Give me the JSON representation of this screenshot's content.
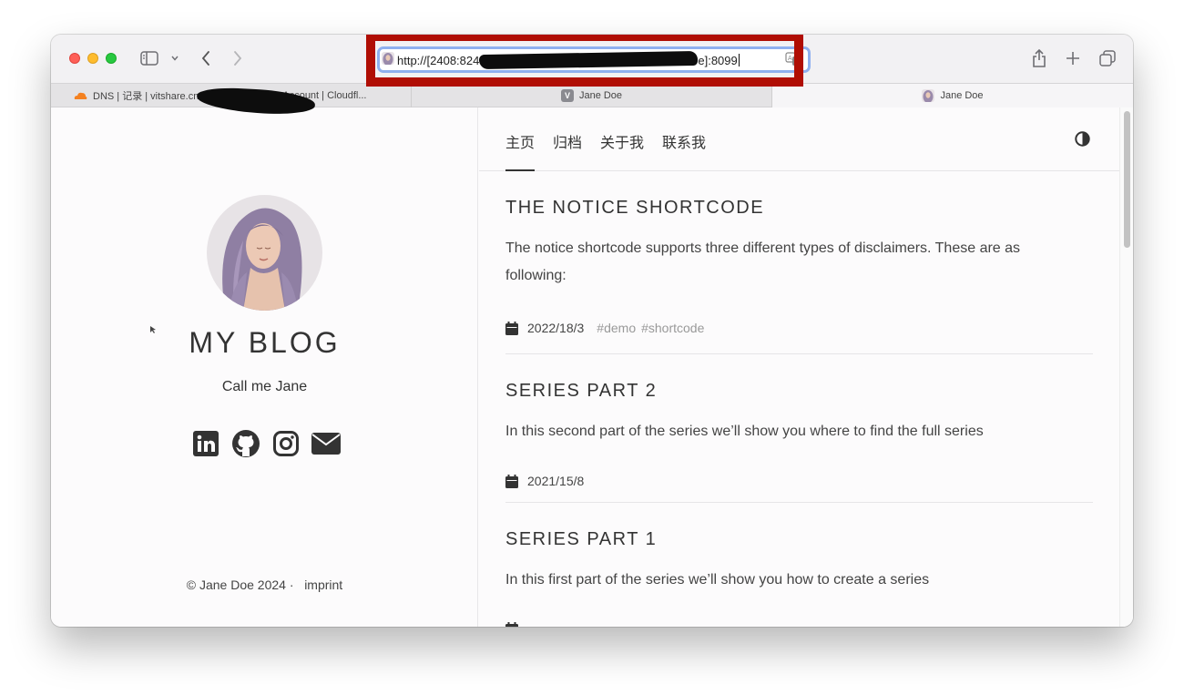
{
  "browser": {
    "url_prefix": "http://[2408:824",
    "url_suffix": "e]:8099",
    "tabs": [
      {
        "label": "DNS | 记录 | vitshare.cn",
        "label_end": "Account | Cloudfl..."
      },
      {
        "label": "Jane Doe"
      },
      {
        "label": "Jane Doe"
      }
    ],
    "highlight_color": "#b00e04"
  },
  "sidebar": {
    "title": "MY BLOG",
    "subtitle": "Call me Jane",
    "socials": [
      "linkedin-icon",
      "github-icon",
      "instagram-icon",
      "email-icon"
    ],
    "footer_copyright": "© Jane Doe 2024 ·",
    "footer_link": "imprint"
  },
  "nav": {
    "items": [
      "主页",
      "归档",
      "关于我",
      "联系我"
    ],
    "active": "主页"
  },
  "posts": [
    {
      "title": "THE NOTICE SHORTCODE",
      "excerpt_line1": "The notice shortcode supports three different types of disclaimers. These are as",
      "excerpt_line2": "following:",
      "date": "2022/18/3",
      "tags": [
        "#demo",
        "#shortcode"
      ]
    },
    {
      "title": "SERIES PART 2",
      "excerpt_line1": "In this second part of the series we’ll show you where to find the full series",
      "date": "2021/15/8"
    },
    {
      "title": "SERIES PART 1",
      "excerpt_line1": "In this first part of the series we’ll show you how to create a series"
    }
  ]
}
